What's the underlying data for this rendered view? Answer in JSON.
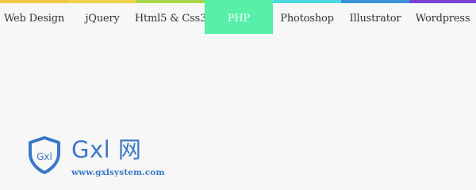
{
  "nav": {
    "items": [
      {
        "label": "Web Design",
        "color": "#f0c847"
      },
      {
        "label": "jQuery",
        "color": "#f0d24a"
      },
      {
        "label": "Html5 & Css3",
        "color": "#a7d64d"
      },
      {
        "label": "PHP",
        "color": "#56f0a8",
        "active": true
      },
      {
        "label": "Photoshop",
        "color": "#4bd8e1"
      },
      {
        "label": "Illustrator",
        "color": "#3b93d8"
      },
      {
        "label": "Wordpress",
        "color": "#7a42d0"
      }
    ]
  },
  "logo": {
    "badge_text": "Gxl",
    "title": "Gxl 网",
    "url": "www.gxlsystem.com",
    "color": "#3a78c9"
  }
}
